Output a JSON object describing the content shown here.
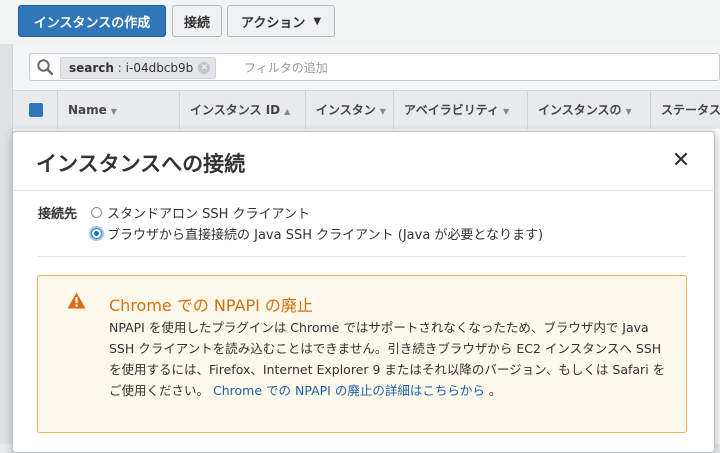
{
  "toolbar": {
    "launch_label": "インスタンスの作成",
    "connect_label": "接続",
    "actions_label": "アクション"
  },
  "search": {
    "token_key": "search",
    "token_sep": ":",
    "token_value": "i-04dbcb9b",
    "placeholder": "フィルタの追加"
  },
  "table": {
    "columns": [
      "Name",
      "インスタンス ID",
      "インスタン",
      "アベイラビリティ",
      "インスタンスの",
      "ステータスチ"
    ]
  },
  "modal": {
    "title": "インスタンスへの接続",
    "connect_with_label": "接続先",
    "option_standalone": "スタンドアロン SSH クライアント",
    "option_browser": "ブラウザから直接接続の Java SSH クライアント (Java が必要となります)",
    "selected_option": "browser",
    "alert": {
      "title": "Chrome での NPAPI の廃止",
      "body": "NPAPI を使用したプラグインは Chrome ではサポートされなくなったため、ブラウザ内で Java SSH クライアントを読み込むことはできません。引き続きブラウザから EC2 インスタンスへ SSH を使用するには、Firefox、Internet Explorer 9 またはそれ以降のバージョン、もしくは Safari をご使用ください。",
      "link_text": "Chrome での NPAPI の廃止の詳細はこちらから",
      "tail": "。"
    }
  },
  "colors": {
    "primary": "#2f77b8",
    "warning": "#d6700d",
    "alert_bg": "#fdf8ec",
    "alert_border": "#e8b550",
    "link": "#1f5fa8"
  }
}
